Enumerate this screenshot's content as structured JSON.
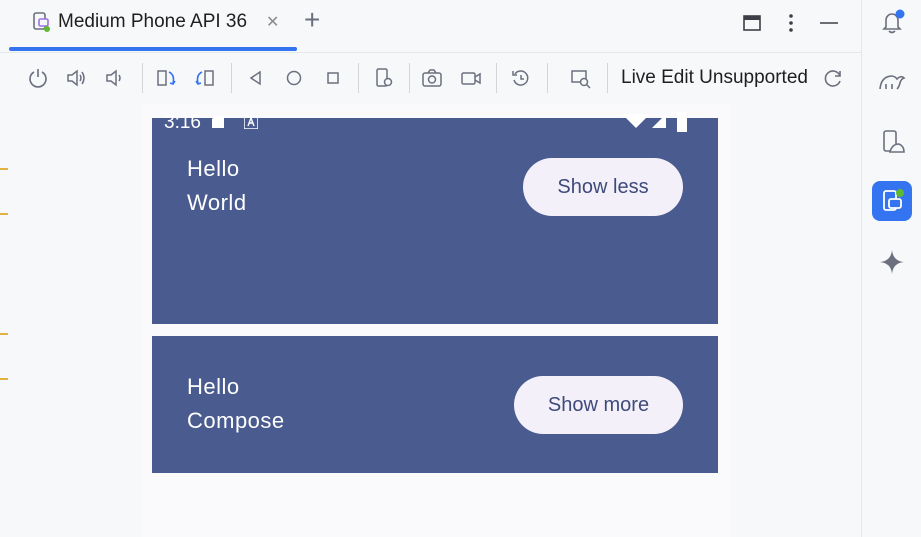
{
  "tab": {
    "label": "Medium Phone API 36"
  },
  "toolbar": {
    "live_edit": "Live Edit Unsupported"
  },
  "device": {
    "status_time": "3:16",
    "cards": [
      {
        "line1": "Hello",
        "line2": "World",
        "button": "Show less"
      },
      {
        "line1": "Hello",
        "line2": "Compose",
        "button": "Show more"
      }
    ]
  },
  "colors": {
    "accent": "#3574f0",
    "card_bg": "#4a5b8f",
    "pill_bg": "#f3f0fa",
    "pill_text": "#3e4a7a"
  },
  "icons": {
    "tab": "device-icon",
    "sidebar": [
      "notifications-icon",
      "gradle-icon",
      "device-manager-icon",
      "running-devices-icon",
      "gemini-icon"
    ]
  }
}
